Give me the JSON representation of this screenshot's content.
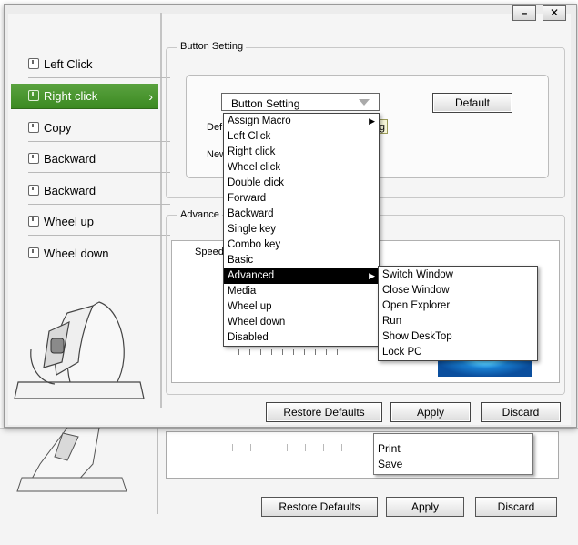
{
  "background_window": {
    "menu_items": [
      "Print",
      "Save"
    ],
    "buttons": {
      "restore": "Restore Defaults",
      "apply": "Apply",
      "discard": "Discard"
    }
  },
  "window": {
    "controls": {
      "minimize": "–",
      "close": "✕"
    }
  },
  "sidebar": {
    "items": [
      {
        "label": "Left Click"
      },
      {
        "label": "Right click",
        "active": true,
        "chevron": "›"
      },
      {
        "label": "Copy"
      },
      {
        "label": "Backward"
      },
      {
        "label": "Backward"
      },
      {
        "label": "Wheel up"
      },
      {
        "label": "Wheel down"
      }
    ]
  },
  "button_setting": {
    "group_label": "Button Setting",
    "combo_value": "Button Setting",
    "default_button": "Default",
    "partial_labels": {
      "def": "Def",
      "new": "New"
    },
    "partial_value": "g"
  },
  "advanced": {
    "group_label": "Advance",
    "speed_label": "Speed"
  },
  "dropdown": {
    "items": [
      {
        "label": "Assign Macro",
        "submenu": true
      },
      {
        "label": "Left Click"
      },
      {
        "label": "Right click"
      },
      {
        "label": "Wheel click"
      },
      {
        "label": "Double click"
      },
      {
        "label": "Forward"
      },
      {
        "label": "Backward"
      },
      {
        "label": "Single key"
      },
      {
        "label": "Combo key"
      },
      {
        "label": "Basic"
      },
      {
        "label": "Advanced",
        "selected": true,
        "submenu": true
      },
      {
        "label": "Media"
      },
      {
        "label": "Wheel up"
      },
      {
        "label": "Wheel down"
      },
      {
        "label": "Disabled"
      }
    ],
    "submenu_arrow": "▶"
  },
  "submenu": {
    "items": [
      "Switch Window",
      "Close Window",
      "Open Explorer",
      "Run",
      "Show DeskTop",
      "Lock PC"
    ]
  },
  "footer": {
    "restore": "Restore Defaults",
    "apply": "Apply",
    "discard": "Discard"
  },
  "colors": {
    "active_green": "#4a9630",
    "selected_menu": "#000000",
    "accent_blue": "#1a7fd1"
  }
}
